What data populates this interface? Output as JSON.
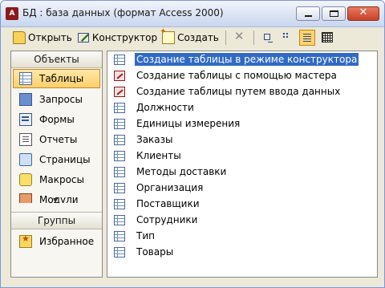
{
  "window": {
    "title": "БД : база данных (формат Access 2000)",
    "app_icon_letter": "A",
    "close_glyph": "✕"
  },
  "toolbar": {
    "open_label": "Открыть",
    "design_label": "Конструктор",
    "create_label": "Создать",
    "active_view": "list-icon"
  },
  "sidebar": {
    "objects_header": "Объекты",
    "items": [
      {
        "label": "Таблицы",
        "icon": "table-icon",
        "selected": true
      },
      {
        "label": "Запросы",
        "icon": "query-icon"
      },
      {
        "label": "Формы",
        "icon": "form-icon"
      },
      {
        "label": "Отчеты",
        "icon": "report-icon"
      },
      {
        "label": "Страницы",
        "icon": "page-icon"
      },
      {
        "label": "Макросы",
        "icon": "macro-icon"
      },
      {
        "label": "Модули",
        "icon": "module-icon"
      }
    ],
    "groups_header": "Группы",
    "favorites_label": "Избранное"
  },
  "objects": {
    "items": [
      {
        "label": "Создание таблицы в режиме конструктора",
        "icon": "design-wizard-icon",
        "selected": true
      },
      {
        "label": "Создание таблицы с помощью мастера",
        "icon": "wizard-icon"
      },
      {
        "label": "Создание таблицы путем ввода данных",
        "icon": "wizard-icon"
      },
      {
        "label": "Должности",
        "icon": "table-icon"
      },
      {
        "label": "Единицы измерения",
        "icon": "table-icon"
      },
      {
        "label": "Заказы",
        "icon": "table-icon"
      },
      {
        "label": "Клиенты",
        "icon": "table-icon"
      },
      {
        "label": "Методы доставки",
        "icon": "table-icon"
      },
      {
        "label": "Организация",
        "icon": "table-icon"
      },
      {
        "label": "Поставщики",
        "icon": "table-icon"
      },
      {
        "label": "Сотрудники",
        "icon": "table-icon"
      },
      {
        "label": "Тип",
        "icon": "table-icon"
      },
      {
        "label": "Товары",
        "icon": "table-icon"
      }
    ]
  },
  "colors": {
    "selection": "#316ac5",
    "nav_selected": "#ffcf6a",
    "window_bg": "#ece9d8"
  }
}
